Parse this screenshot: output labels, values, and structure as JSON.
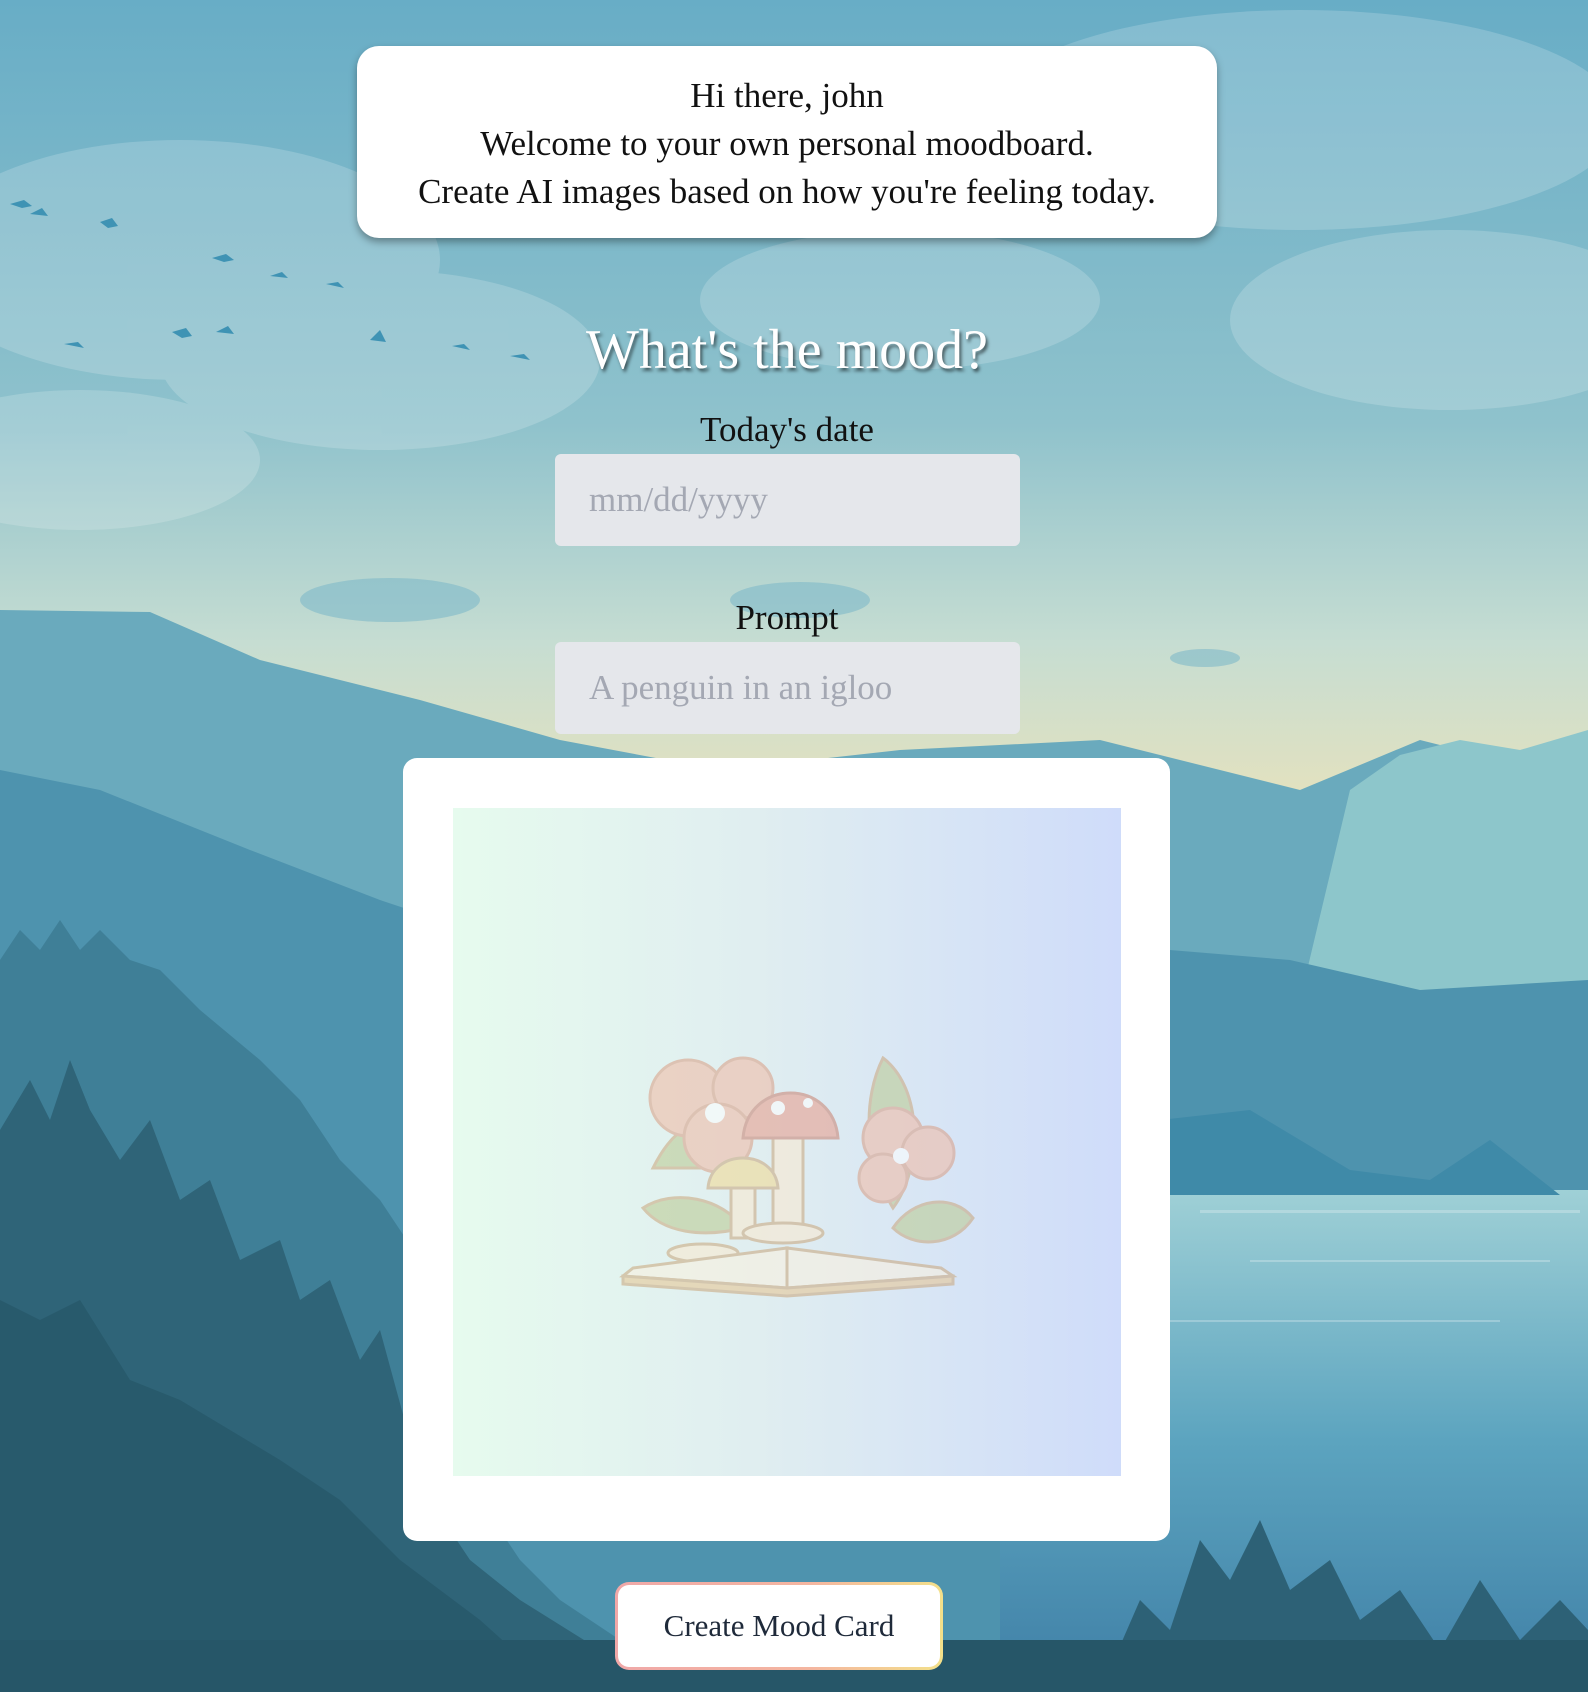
{
  "greeting": {
    "line1": "Hi there, john",
    "line2": "Welcome to your own personal moodboard.",
    "line3": "Create AI images based on how you're feeling today."
  },
  "form": {
    "title": "What's the mood?",
    "date_label": "Today's date",
    "date_placeholder": "mm/dd/yyyy",
    "prompt_label": "Prompt",
    "prompt_placeholder": "A penguin in an igloo"
  },
  "card": {
    "image": "open-book-with-flowers-and-mushrooms-illustration"
  },
  "actions": {
    "create_label": "Create Mood Card"
  },
  "colors": {
    "field_bg": "#e5e7eb",
    "placeholder": "#a4a8b3",
    "button_border": "#f0a8a8"
  }
}
